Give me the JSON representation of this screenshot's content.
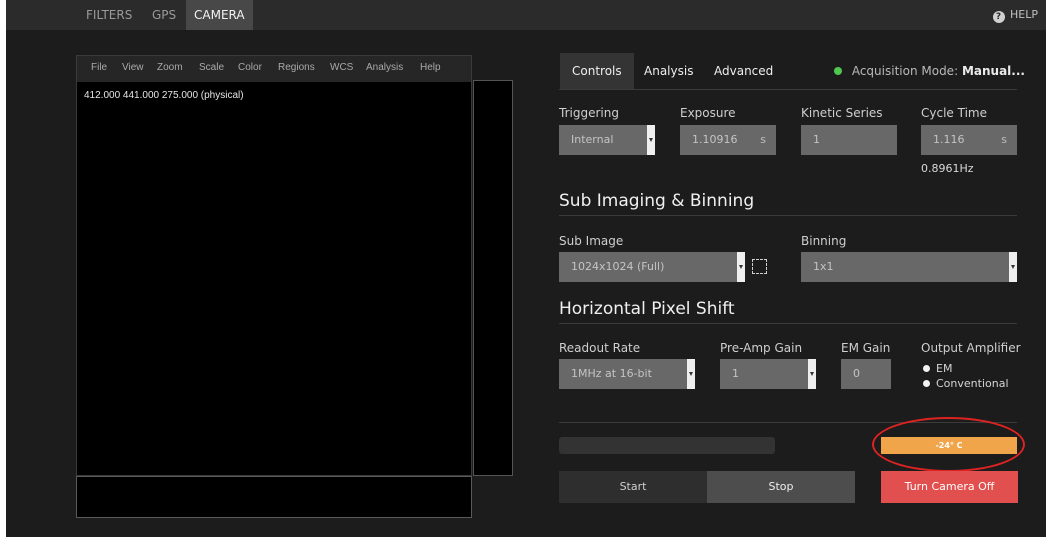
{
  "nav": {
    "tabs": [
      {
        "label": "FILTERS"
      },
      {
        "label": "GPS"
      },
      {
        "label": "CAMERA"
      }
    ],
    "help_label": "HELP",
    "help_icon": "question-circle-icon"
  },
  "viewer": {
    "menu": [
      "File",
      "View",
      "Zoom",
      "Scale",
      "Color",
      "Regions",
      "WCS",
      "Analysis",
      "Help"
    ],
    "coords": "412.000   441.000 275.000 (physical)"
  },
  "panel": {
    "tabs": [
      {
        "label": "Controls"
      },
      {
        "label": "Analysis"
      },
      {
        "label": "Advanced"
      }
    ],
    "acquisition_label": "Acquisition Mode:",
    "acquisition_value": "Manual...",
    "status_color": "#4fc84f"
  },
  "controls": {
    "triggering": {
      "label": "Triggering",
      "value": "Internal"
    },
    "exposure": {
      "label": "Exposure",
      "value": "1.10916",
      "unit": "s"
    },
    "kinetic": {
      "label": "Kinetic Series",
      "value": "1"
    },
    "cycle": {
      "label": "Cycle Time",
      "value": "1.116",
      "unit": "s",
      "freq": "0.8961Hz"
    }
  },
  "sub_imaging": {
    "title": "Sub Imaging & Binning",
    "sub_image": {
      "label": "Sub Image",
      "value": "1024x1024 (Full)"
    },
    "binning": {
      "label": "Binning",
      "value": "1x1"
    }
  },
  "pixel_shift": {
    "title": "Horizontal Pixel Shift",
    "readout": {
      "label": "Readout Rate",
      "value": "1MHz at 16-bit"
    },
    "preamp": {
      "label": "Pre-Amp Gain",
      "value": "1"
    },
    "em_gain": {
      "label": "EM Gain",
      "value": "0"
    },
    "output": {
      "label": "Output Amplifier",
      "options": [
        "EM",
        "Conventional"
      ]
    }
  },
  "status": {
    "temperature": "-24° C",
    "temperature_color": "#f0a54a"
  },
  "buttons": {
    "start": "Start",
    "stop": "Stop",
    "camera_off": "Turn Camera Off",
    "camera_off_color": "#e24f4f"
  }
}
